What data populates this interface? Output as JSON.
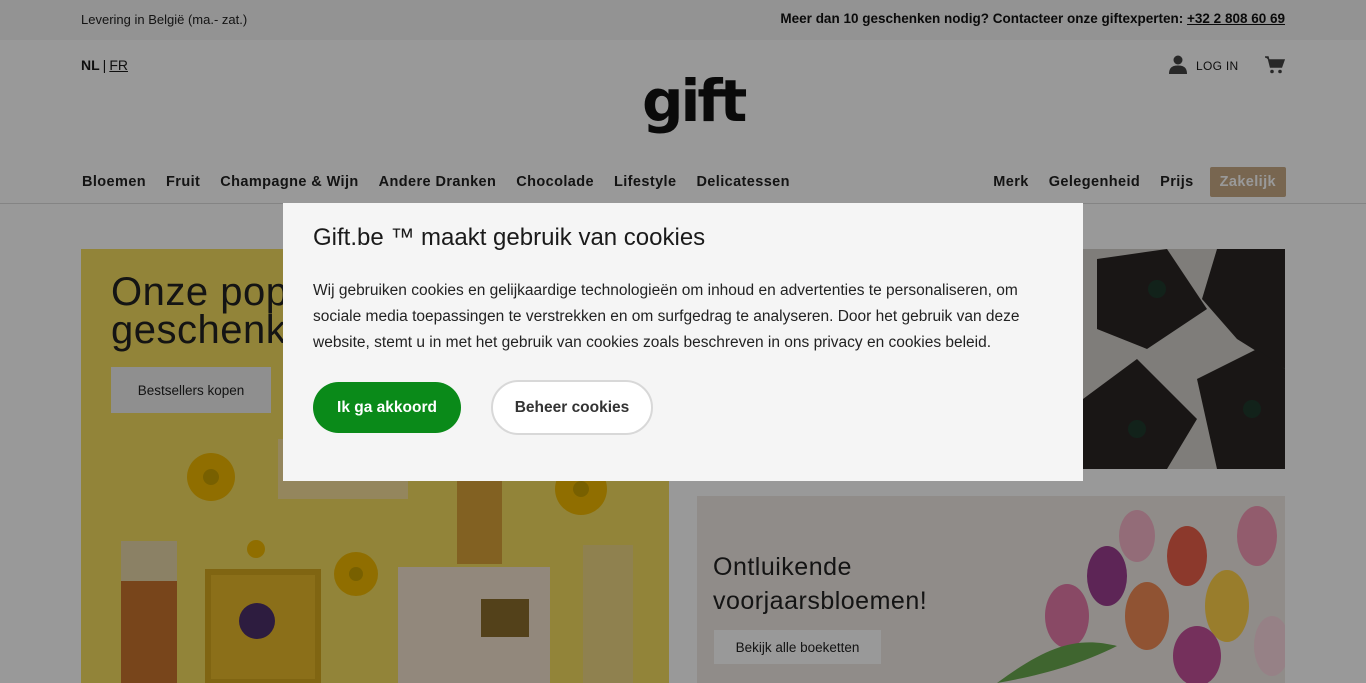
{
  "topbar": {
    "delivery": "Levering in België (ma.- zat.)",
    "contact_text": "Meer dan 10 geschenken nodig? Contacteer onze giftexperten:",
    "phone": "+32 2 808 60 69"
  },
  "header": {
    "lang_nl": "NL",
    "lang_sep": "|",
    "lang_fr": "FR",
    "logo": "gift",
    "login": "LOG IN"
  },
  "nav": {
    "left": [
      "Bloemen",
      "Fruit",
      "Champagne & Wijn",
      "Andere Dranken",
      "Chocolade",
      "Lifestyle",
      "Delicatessen"
    ],
    "right": [
      "Merk",
      "Gelegenheid",
      "Prijs"
    ],
    "business": "Zakelijk"
  },
  "hero": {
    "left_title_1": "Onze pop",
    "left_title_2": "geschenk",
    "left_button": "Bestsellers kopen",
    "bottom_title_1": "Ontluikende",
    "bottom_title_2": "voorjaarsbloemen!",
    "bottom_button": "Bekijk alle boeketten"
  },
  "cookie": {
    "title": "Gift.be ™ maakt gebruik van cookies",
    "body": "Wij gebruiken cookies en gelijkaardige technologieën om inhoud en advertenties te personaliseren, om sociale media toepassingen te verstrekken en om surfgedrag te analyseren. Door het gebruik van deze website, stemt u in met het gebruik van cookies zoals beschreven in ons privacy en cookies beleid.",
    "accept": "Ik ga akkoord",
    "manage": "Beheer cookies"
  }
}
